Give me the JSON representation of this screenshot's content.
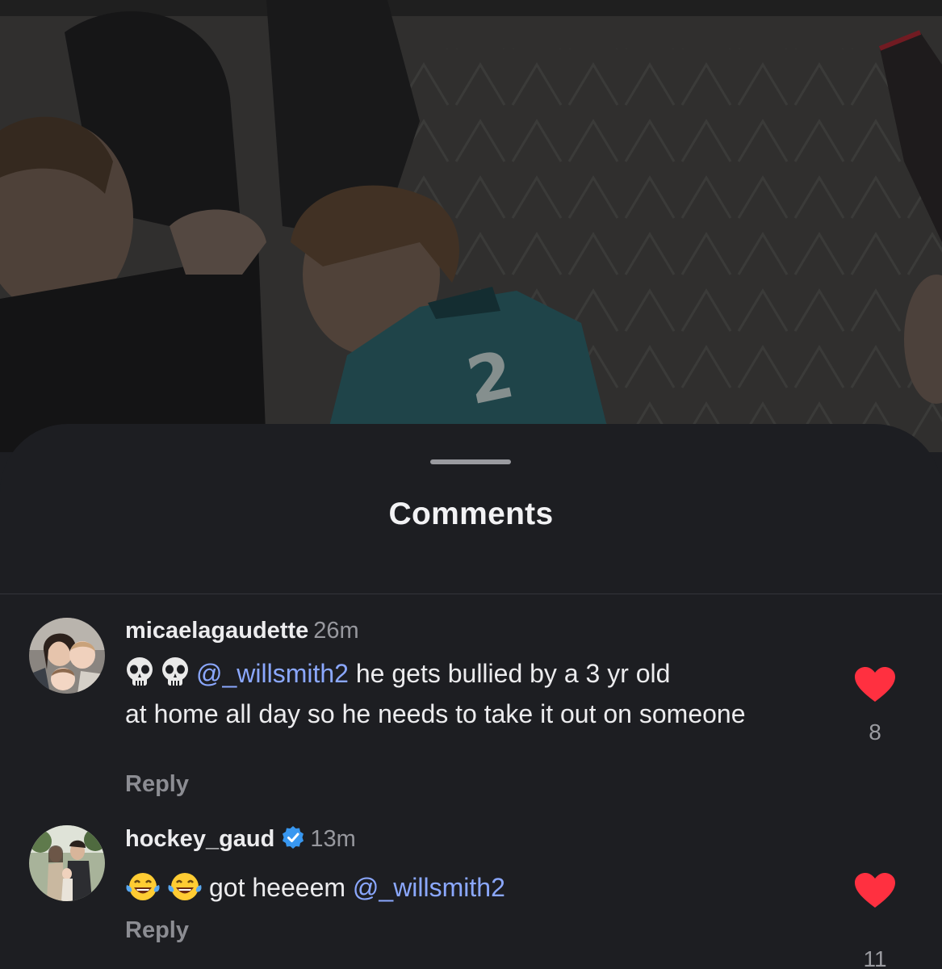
{
  "sheet": {
    "title": "Comments"
  },
  "colors": {
    "background": "#1d1e22",
    "mention": "#8ba8ff",
    "like_heart": "#ff3040",
    "verified_badge": "#3897f0"
  },
  "comments": [
    {
      "username": "micaelagaudette",
      "time": "26m",
      "verified": false,
      "emojis": [
        "skull-emoji",
        "skull-emoji"
      ],
      "mention": "@_willsmith2",
      "text_line1": " he gets bullied by a 3 yr old",
      "text_rest": "at home all day so he needs to take it out on someone",
      "reply_label": "Reply",
      "likes": "8",
      "liked": true
    },
    {
      "username": "hockey_gaud",
      "time": "13m",
      "verified": true,
      "emojis": [
        "tears-of-joy-emoji",
        "tears-of-joy-emoji"
      ],
      "text": "got heeeem ",
      "mention": "@_willsmith2",
      "reply_label": "Reply",
      "likes": "11",
      "liked": true
    }
  ]
}
